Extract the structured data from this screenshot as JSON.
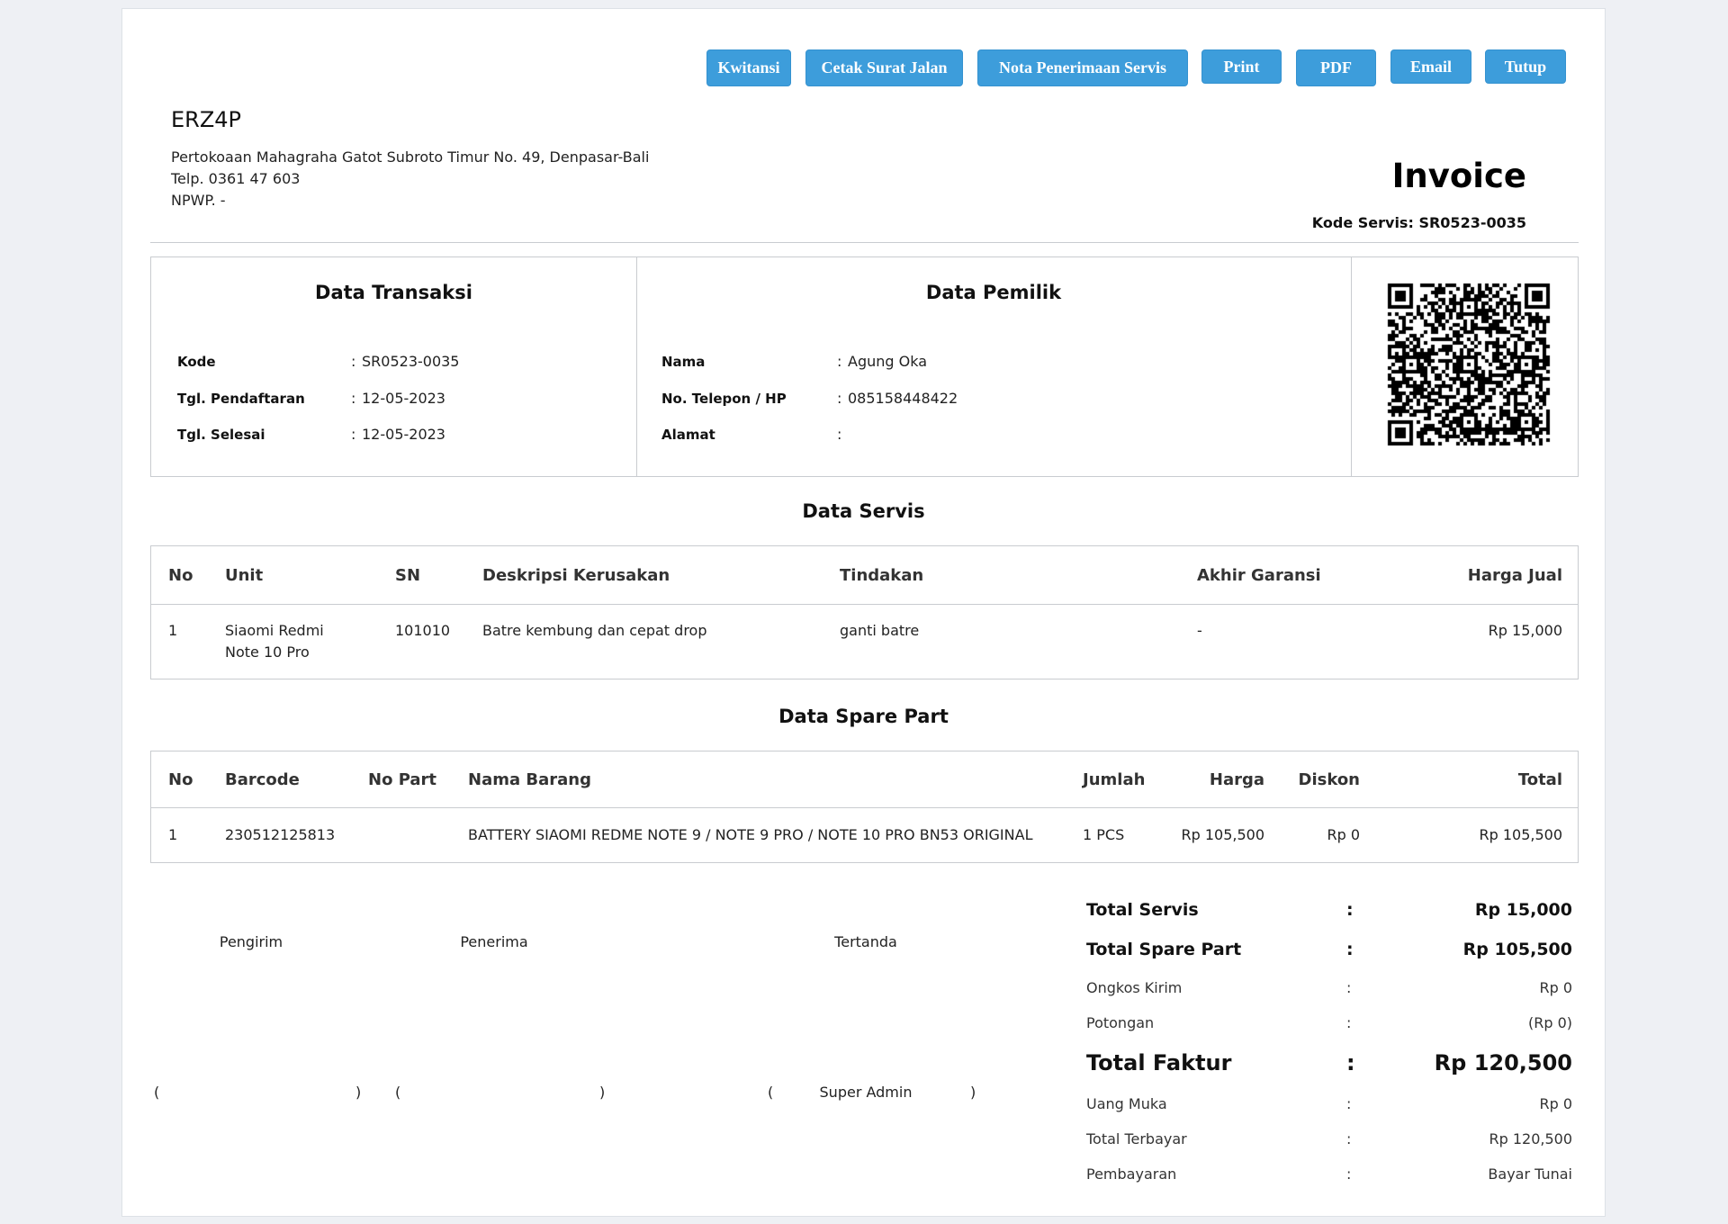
{
  "theme": {
    "button_color": "#3d9ddb"
  },
  "toolbar": {
    "kwitansi": "Kwitansi",
    "surat_jalan": "Cetak Surat Jalan",
    "nota_penerimaan": "Nota Penerimaan Servis",
    "print": "Print",
    "pdf": "PDF",
    "email": "Email",
    "tutup": "Tutup"
  },
  "company": {
    "name": "ERZ4P",
    "address": "Pertokoaan Mahagraha Gatot Subroto Timur No. 49, Denpasar-Bali",
    "phone": "Telp. 0361 47 603",
    "npwp": "NPWP. -"
  },
  "invoice": {
    "title": "Invoice",
    "code_label": "Kode Servis:",
    "code": "SR0523-0035"
  },
  "separator": ":",
  "transaksi": {
    "heading": "Data Transaksi",
    "rows": [
      {
        "label": "Kode",
        "value": "SR0523-0035"
      },
      {
        "label": "Tgl. Pendaftaran",
        "value": "12-05-2023"
      },
      {
        "label": "Tgl. Selesai",
        "value": "12-05-2023"
      }
    ]
  },
  "pemilik": {
    "heading": "Data Pemilik",
    "rows": [
      {
        "label": "Nama",
        "value": "Agung Oka"
      },
      {
        "label": "No. Telepon / HP",
        "value": "085158448422"
      },
      {
        "label": "Alamat",
        "value": ""
      }
    ]
  },
  "servis": {
    "heading": "Data Servis",
    "columns": [
      "No",
      "Unit",
      "SN",
      "Deskripsi Kerusakan",
      "Tindakan",
      "Akhir Garansi",
      "Harga Jual"
    ],
    "rows": [
      [
        "1",
        "Siaomi Redmi Note 10 Pro",
        "101010",
        "Batre kembung dan cepat drop",
        "ganti batre",
        "-",
        "Rp 15,000"
      ]
    ]
  },
  "sparepart": {
    "heading": "Data Spare Part",
    "columns": [
      "No",
      "Barcode",
      "No Part",
      "Nama Barang",
      "Jumlah",
      "Harga",
      "Diskon",
      "Total"
    ],
    "rows": [
      [
        "1",
        "230512125813",
        "",
        "BATTERY SIAOMI REDME NOTE 9 / NOTE 9 PRO / NOTE 10 PRO BN53 ORIGINAL",
        "1 PCS",
        "Rp 105,500",
        "Rp 0",
        "Rp 105,500"
      ]
    ]
  },
  "signatures": {
    "open": "(",
    "close": ")",
    "pengirim": "Pengirim",
    "penerima": "Penerima",
    "tertanda": "Tertanda",
    "tertanda_name": "Super Admin"
  },
  "summary": [
    {
      "label": "Total Servis",
      "value": "Rp 15,000"
    },
    {
      "label": "Total Spare Part",
      "value": "Rp 105,500"
    },
    {
      "label": "Ongkos Kirim",
      "value": "Rp 0"
    },
    {
      "label": "Potongan",
      "value": "(Rp 0)"
    },
    {
      "label": "Total Faktur",
      "value": "Rp 120,500"
    },
    {
      "label": "Uang Muka",
      "value": "Rp 0"
    },
    {
      "label": "Total Terbayar",
      "value": "Rp 120,500"
    },
    {
      "label": "Pembayaran",
      "value": "Bayar Tunai"
    }
  ]
}
